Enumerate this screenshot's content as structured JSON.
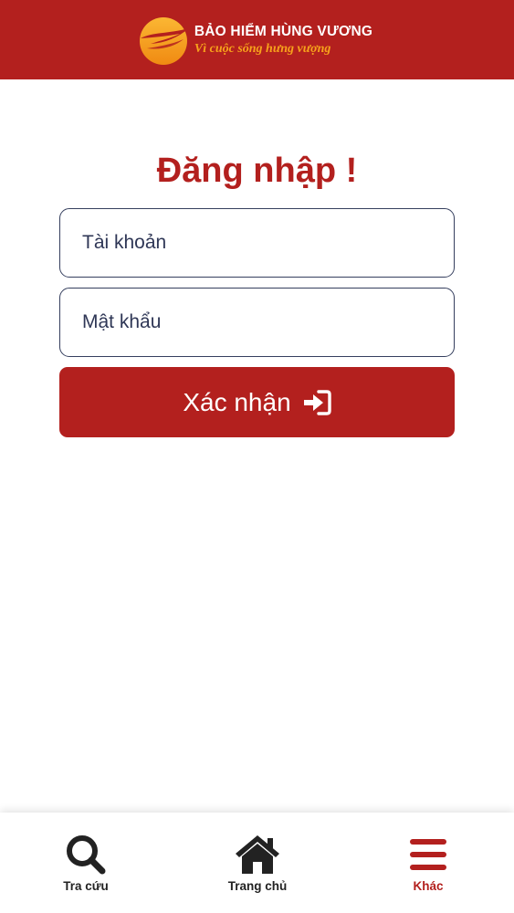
{
  "colors": {
    "brand_red": "#b3201e",
    "slogan_orange": "#f7a21b",
    "field_border": "#353f5e",
    "nav_text": "#222222"
  },
  "header": {
    "brand_name": "BẢO HIỂM HÙNG VƯƠNG",
    "slogan": "Vì cuộc sống hưng vượng",
    "logo_icon": "sun-bird-logo-icon"
  },
  "login": {
    "title": "Đăng nhập !",
    "username_placeholder": "Tài khoản",
    "password_placeholder": "Mật khẩu",
    "submit_label": "Xác nhận",
    "submit_icon": "sign-in-icon"
  },
  "bottom_nav": {
    "items": [
      {
        "label": "Tra cứu",
        "icon": "search-icon",
        "active": false
      },
      {
        "label": "Trang chủ",
        "icon": "home-icon",
        "active": false
      },
      {
        "label": "Khác",
        "icon": "menu-icon",
        "active": true
      }
    ]
  }
}
